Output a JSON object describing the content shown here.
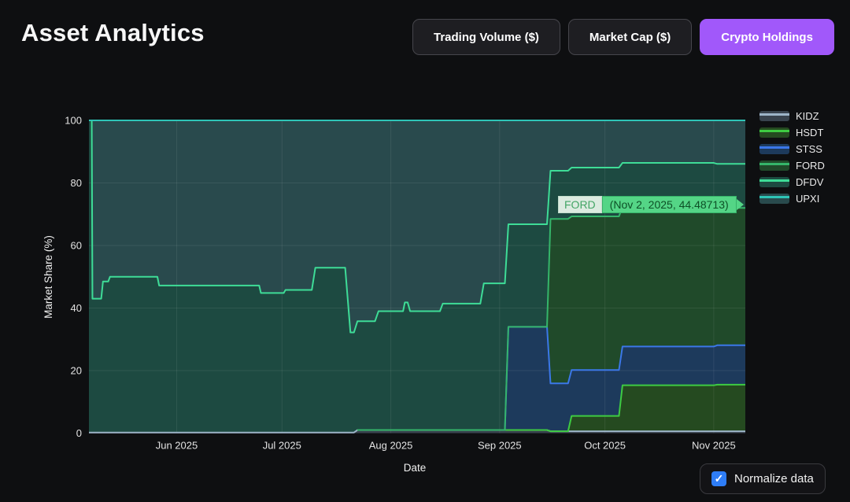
{
  "header": {
    "title": "Asset Analytics",
    "buttons": [
      {
        "label": "Trading Volume ($)",
        "active": false
      },
      {
        "label": "Market Cap ($)",
        "active": false
      },
      {
        "label": "Crypto Holdings",
        "active": true
      }
    ]
  },
  "colors": {
    "page_bg": "#0e0f11",
    "accent_purple": "#a158fa",
    "checkbox_blue": "#2e7df7",
    "grid": "rgba(255,255,255,0.08)",
    "tick_text": "#e3e3e3"
  },
  "tooltip": {
    "series": "FORD",
    "value_text": "(Nov 2, 2025, 44.48713)"
  },
  "controls": {
    "normalize_label": "Normalize data",
    "checkmark": "✓",
    "checked": true
  },
  "chart_data": {
    "type": "area",
    "stacked": true,
    "normalized": true,
    "title": "",
    "xlabel": "Date",
    "ylabel": "Market Share (%)",
    "ylim": [
      0,
      100
    ],
    "yticks": [
      0,
      20,
      40,
      60,
      80,
      100
    ],
    "x_start_date": "2025-05-07",
    "x_range_days": [
      0,
      187
    ],
    "xticks": [
      {
        "day": 25,
        "label": "Jun 2025"
      },
      {
        "day": 55,
        "label": "Jul 2025"
      },
      {
        "day": 86,
        "label": "Aug 2025"
      },
      {
        "day": 117,
        "label": "Sep 2025"
      },
      {
        "day": 147,
        "label": "Oct 2025"
      },
      {
        "day": 178,
        "label": "Nov 2025"
      }
    ],
    "legend_position": "top-right",
    "grid": true,
    "stack_order_bottom_to_top": [
      "KIDZ",
      "HSDT",
      "STSS",
      "FORD",
      "DFDV",
      "UPXI"
    ],
    "segments_days": [
      [
        0,
        0.8
      ],
      [
        1,
        3.5
      ],
      [
        4,
        5.5
      ],
      [
        6,
        19.5
      ],
      [
        20,
        48.5
      ],
      [
        49,
        55.5
      ],
      [
        56,
        63.5
      ],
      [
        64.5,
        73
      ],
      [
        74.5,
        75.5
      ],
      [
        76.5,
        81.5
      ],
      [
        82.5,
        89.5
      ],
      [
        90,
        90.8
      ],
      [
        91.5,
        100
      ],
      [
        100.8,
        111.5
      ],
      [
        112.5,
        118.5
      ],
      [
        119.5,
        130.5
      ],
      [
        131.5,
        136.5
      ],
      [
        137.5,
        151
      ],
      [
        152,
        178
      ],
      [
        179,
        180
      ],
      [
        181,
        187
      ]
    ],
    "series": [
      {
        "name": "KIDZ",
        "line": "#9db4c8",
        "fill": "#39434e",
        "values": [
          0.2,
          0.2,
          0.2,
          0.2,
          0.2,
          0.2,
          0.2,
          0.2,
          0.2,
          1,
          1,
          1,
          1,
          1,
          1,
          1,
          0.6,
          0.6,
          0.6,
          0.6,
          0.6
        ]
      },
      {
        "name": "HSDT",
        "line": "#3ecb42",
        "fill": "#254a20",
        "values": [
          null,
          null,
          null,
          null,
          null,
          null,
          null,
          null,
          null,
          0,
          0,
          0,
          0,
          0,
          0,
          0,
          0,
          4.9,
          14.7,
          14.9,
          14.9
        ]
      },
      {
        "name": "STSS",
        "line": "#3b77e8",
        "fill": "#1d3a5c",
        "values": [
          null,
          null,
          null,
          null,
          null,
          null,
          null,
          null,
          null,
          null,
          null,
          null,
          null,
          null,
          0,
          33,
          15.3,
          14.7,
          12.4,
          12.6,
          12.6
        ]
      },
      {
        "name": "FORD",
        "line": "#35b56a",
        "fill": "#204a2a",
        "values": [
          null,
          null,
          null,
          null,
          null,
          null,
          null,
          null,
          null,
          0,
          0,
          0,
          0,
          0,
          0,
          0,
          52.6,
          49.1,
          44.6,
          44.487,
          43.9
        ]
      },
      {
        "name": "DFDV",
        "line": "#3edc97",
        "fill": "#1d4a41",
        "values": [
          99.8,
          42.8,
          48.3,
          49.8,
          47,
          44.6,
          45.6,
          52.7,
          32,
          34.8,
          38,
          40.8,
          38,
          40.4,
          46.9,
          32.8,
          15.4,
          15.6,
          14.1,
          13.5,
          14.1
        ]
      },
      {
        "name": "UPXI",
        "line": "#2ec4b6",
        "fill": "#294a4d",
        "values": [
          0,
          57,
          51.5,
          50,
          52.8,
          55.2,
          54.2,
          47.1,
          67.8,
          64.2,
          61,
          58.2,
          61,
          58.6,
          52.1,
          33.2,
          16.1,
          15.1,
          13.6,
          13.9,
          13.9
        ]
      }
    ],
    "hover_point": {
      "series": "FORD",
      "date": "Nov 2, 2025",
      "value": 44.48713
    }
  }
}
